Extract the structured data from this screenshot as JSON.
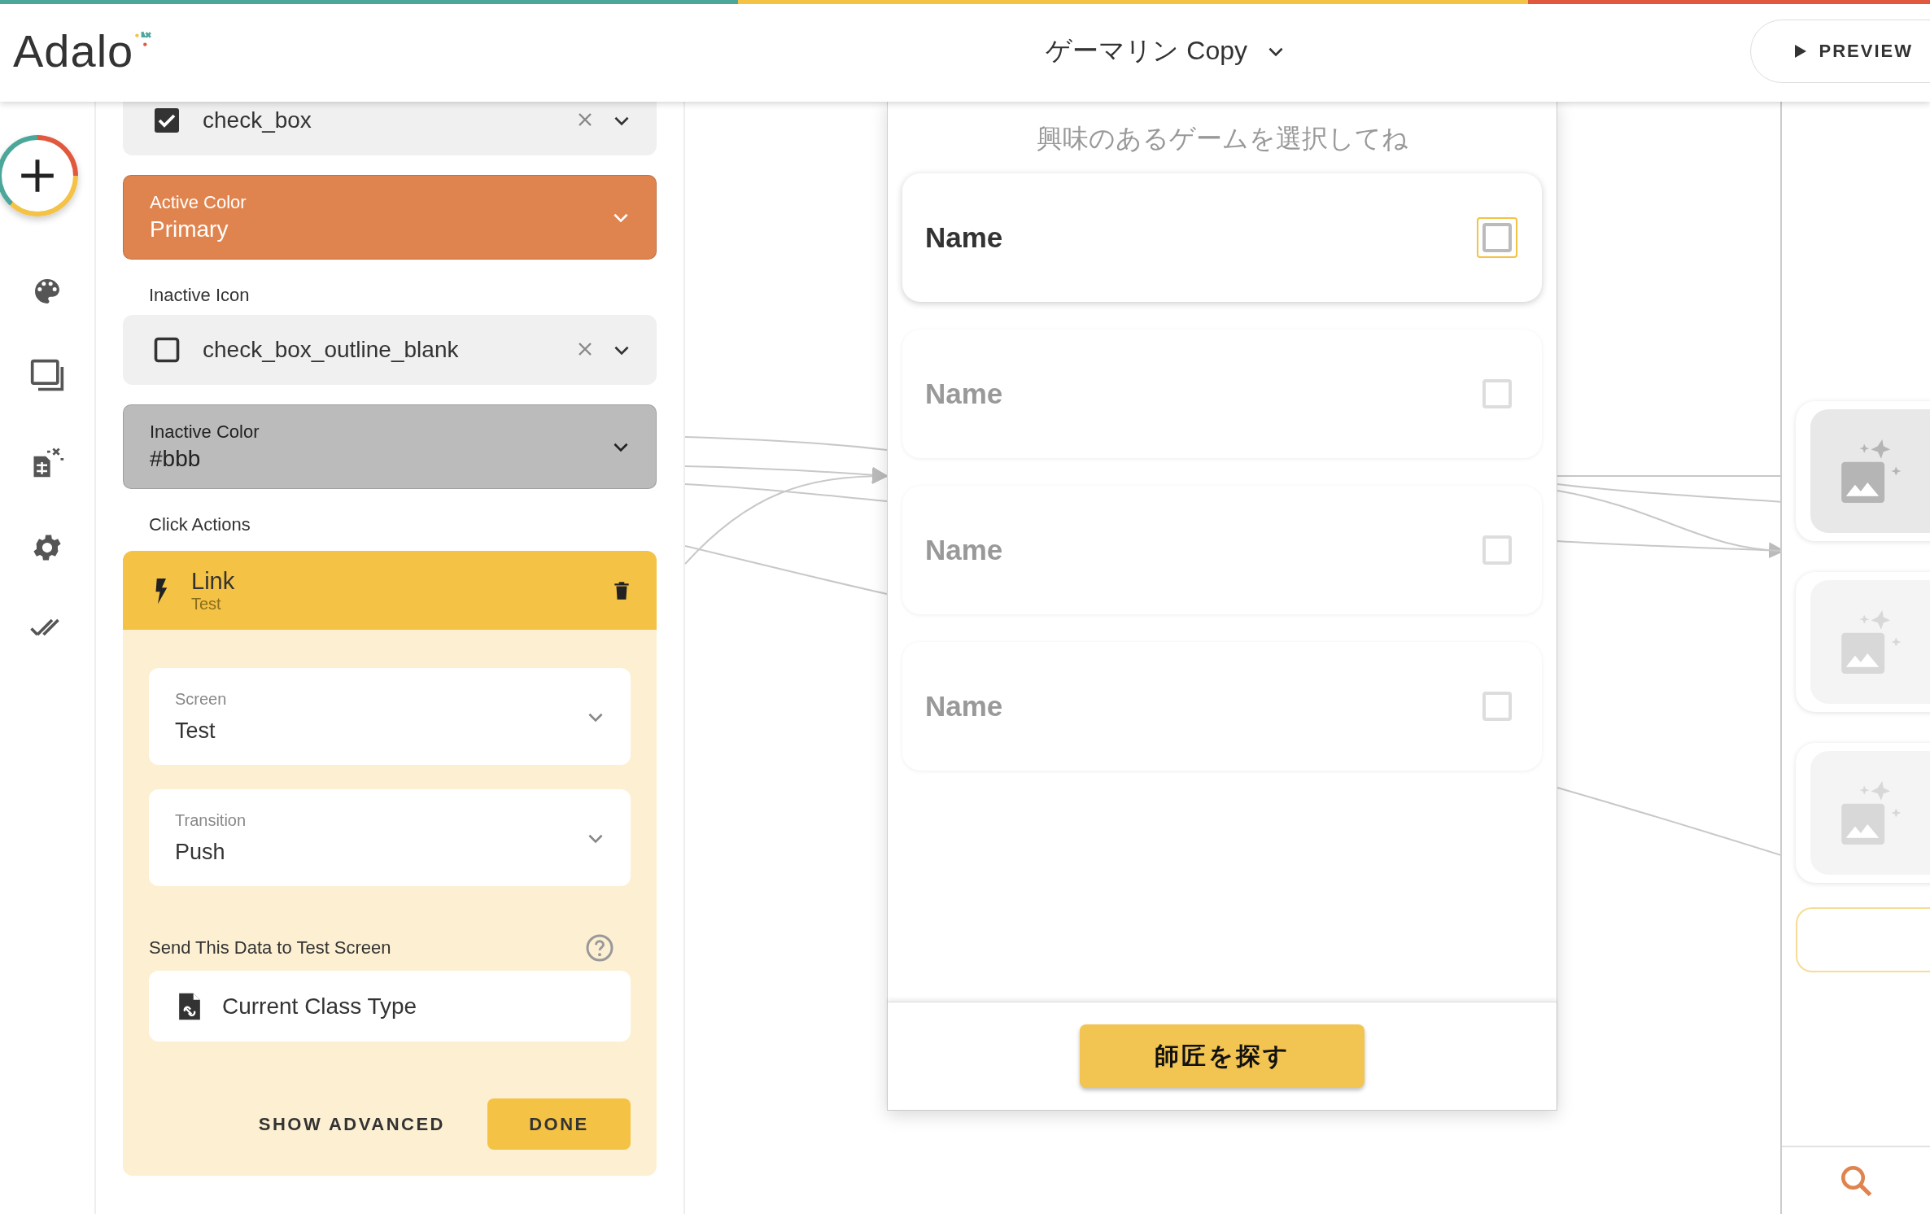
{
  "top_bar": {
    "logo": "Adalo",
    "app_name": "ゲーマリン Copy",
    "preview_button": "PREVIEW"
  },
  "panel": {
    "active_icon": {
      "value": "check_box"
    },
    "active_color": {
      "label": "Active Color",
      "value": "Primary",
      "color": "#e0844f"
    },
    "inactive_icon": {
      "label": "Inactive Icon",
      "value": "check_box_outline_blank"
    },
    "inactive_color": {
      "label": "Inactive Color",
      "value": "#bbb",
      "color": "#bbbbbb"
    },
    "click_actions": {
      "label": "Click Actions",
      "action": {
        "title": "Link",
        "subtitle": "Test",
        "expanded": true
      },
      "fields": [
        {
          "label": "Screen",
          "value": "Test"
        },
        {
          "label": "Transition",
          "value": "Push"
        }
      ],
      "send_label": "Send This Data to Test Screen",
      "send_value": "Current Class Type",
      "advanced_button": "SHOW ADVANCED",
      "done_button": "DONE"
    }
  },
  "phone": {
    "heading": "興味のあるゲームを選択してね",
    "rows": [
      {
        "label": "Name",
        "selected": true
      },
      {
        "label": "Name",
        "selected": false
      },
      {
        "label": "Name",
        "selected": false
      },
      {
        "label": "Name",
        "selected": false
      }
    ],
    "button": "師匠を探す"
  },
  "screens": [
    {
      "selected": true
    },
    {
      "selected": false
    },
    {
      "selected": false
    }
  ]
}
